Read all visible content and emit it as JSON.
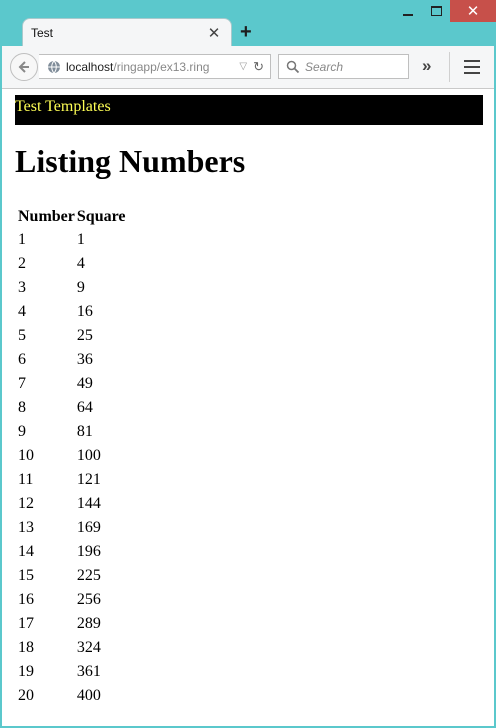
{
  "window": {
    "tab_title": "Test"
  },
  "nav": {
    "url_host": "localhost",
    "url_path": "/ringapp/ex13.ring",
    "search_placeholder": "Search"
  },
  "page": {
    "banner": "Test Templates",
    "heading": "Listing Numbers",
    "columns": [
      "Number",
      "Square"
    ],
    "rows": [
      [
        "1",
        "1"
      ],
      [
        "2",
        "4"
      ],
      [
        "3",
        "9"
      ],
      [
        "4",
        "16"
      ],
      [
        "5",
        "25"
      ],
      [
        "6",
        "36"
      ],
      [
        "7",
        "49"
      ],
      [
        "8",
        "64"
      ],
      [
        "9",
        "81"
      ],
      [
        "10",
        "100"
      ],
      [
        "11",
        "121"
      ],
      [
        "12",
        "144"
      ],
      [
        "13",
        "169"
      ],
      [
        "14",
        "196"
      ],
      [
        "15",
        "225"
      ],
      [
        "16",
        "256"
      ],
      [
        "17",
        "289"
      ],
      [
        "18",
        "324"
      ],
      [
        "19",
        "361"
      ],
      [
        "20",
        "400"
      ]
    ]
  }
}
